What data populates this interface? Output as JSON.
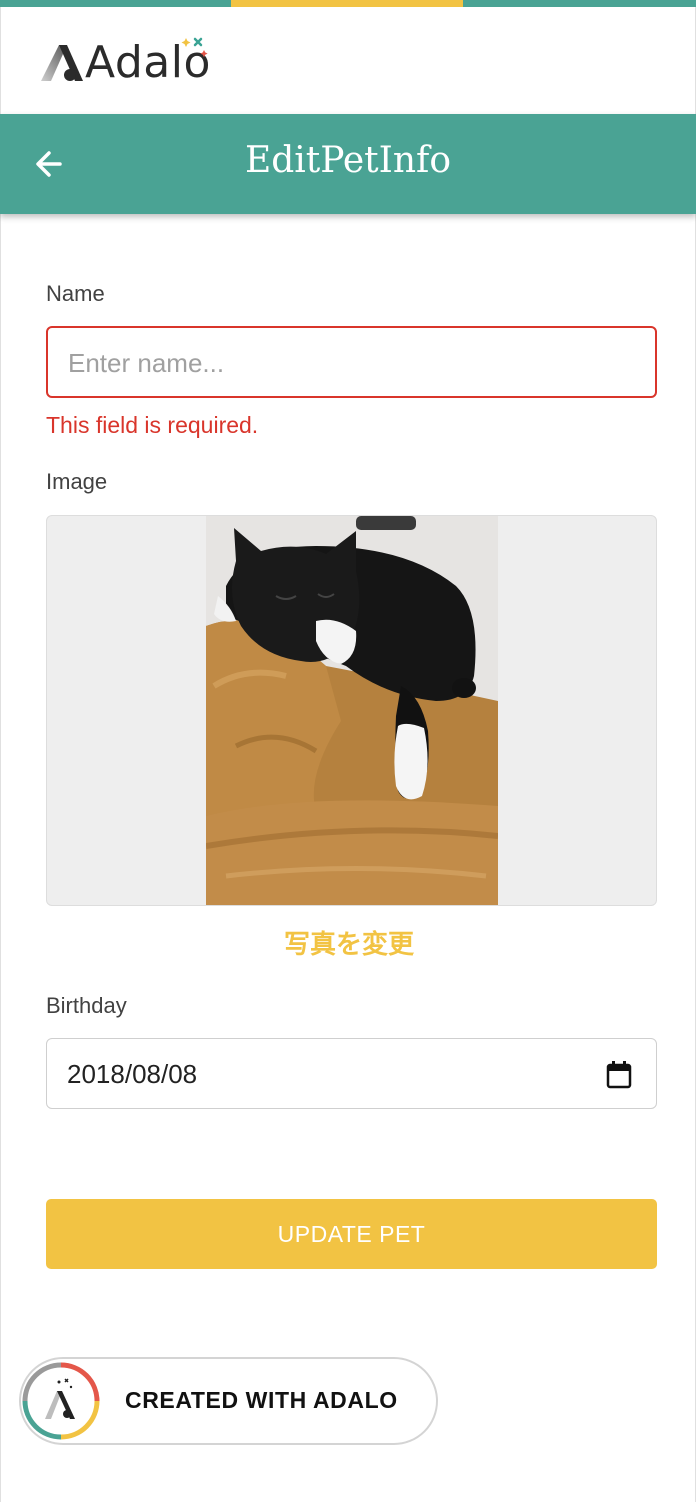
{
  "colors": {
    "teal": "#4aa394",
    "yellow": "#f2c343",
    "error": "#d9352b"
  },
  "brand": {
    "logo_text": "Adalo"
  },
  "appbar": {
    "title": "EditPetInfo",
    "back_icon": "arrow-left-icon"
  },
  "form": {
    "name": {
      "label": "Name",
      "value": "",
      "placeholder": "Enter name...",
      "error": "This field is required."
    },
    "image": {
      "label": "Image",
      "photo_alt": "black and white cat sleeping on a tan leather sofa",
      "change_label": "写真を変更"
    },
    "birthday": {
      "label": "Birthday",
      "value": "2018/08/08",
      "icon": "calendar-icon"
    },
    "submit_label": "UPDATE PET"
  },
  "badge": {
    "label": "CREATED WITH ADALO",
    "icon": "adalo-badge-icon"
  }
}
